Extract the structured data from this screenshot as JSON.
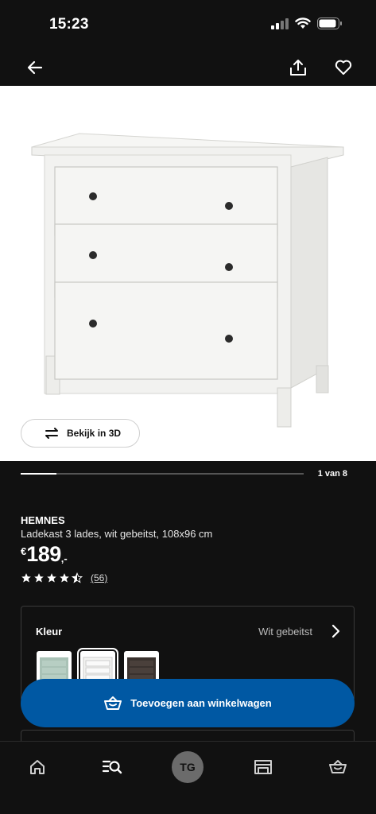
{
  "status": {
    "time": "15:23"
  },
  "nav": {
    "back_icon": "arrow-left-icon",
    "share_icon": "share-icon",
    "favorite_icon": "heart-icon"
  },
  "hero": {
    "view3d_label": "Bekijk in 3D",
    "view3d_icon": "rotate-3d-icon"
  },
  "gallery": {
    "page_indicator": "1 van 8",
    "progress": 0.125
  },
  "product": {
    "name": "HEMNES",
    "description": "Ladekast 3 lades, wit gebeitst, 108x96 cm",
    "price_currency": "€",
    "price_integer": "189",
    "price_decimal": ",-",
    "rating": 4.5,
    "review_count": "(56)"
  },
  "color_selector": {
    "label": "Kleur",
    "value": "Wit gebeitst",
    "options": [
      {
        "name": "grey-green",
        "color": "#a9c2b6"
      },
      {
        "name": "white stain",
        "color": "#f4f4f2",
        "selected": true
      },
      {
        "name": "black-brown",
        "color": "#3a322e"
      }
    ]
  },
  "cart": {
    "add_label": "Toevoegen aan winkelwagen",
    "accent": "#0058a3"
  },
  "tabs": {
    "avatar_initials": "TG"
  }
}
